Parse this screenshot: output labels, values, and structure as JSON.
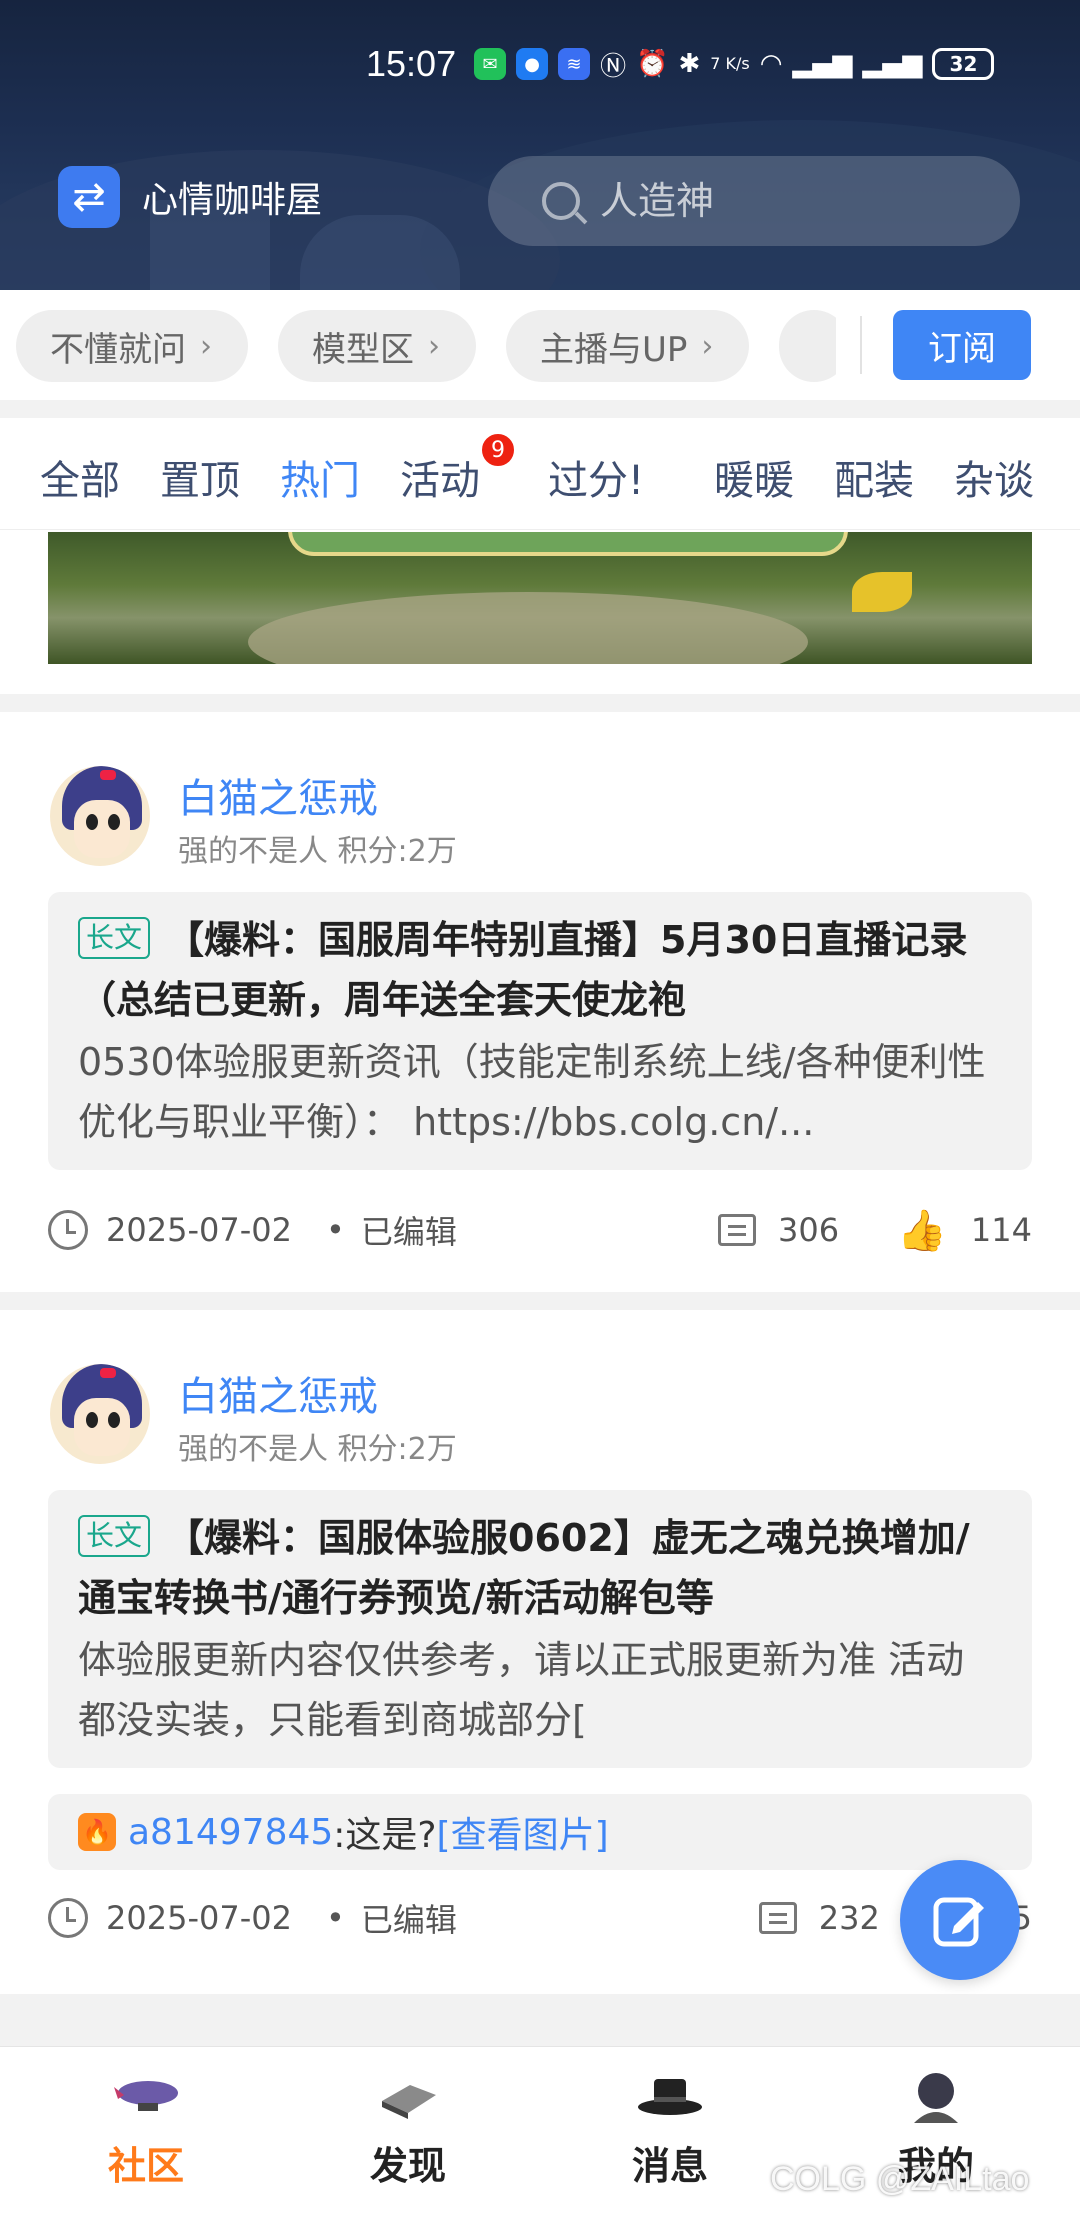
{
  "status_bar": {
    "time": "15:07",
    "net_speed": "7 K/s",
    "battery": "32"
  },
  "header": {
    "app_title": "心情咖啡屋",
    "search_placeholder": "人造神"
  },
  "chips": [
    "不懂就问",
    "模型区",
    "主播与UP",
    ""
  ],
  "subscribe_label": "订阅",
  "tabs": [
    {
      "label": "全部"
    },
    {
      "label": "置顶"
    },
    {
      "label": "热门",
      "active": true
    },
    {
      "label": "活动",
      "badge": "9"
    },
    {
      "label": "过分!"
    },
    {
      "label": "暖暖"
    },
    {
      "label": "配装"
    },
    {
      "label": "杂谈"
    }
  ],
  "posts": [
    {
      "author": "白猫之惩戒",
      "author_meta": "强的不是人 积分:2万",
      "tag": "长文",
      "title": "【爆料：国服周年特别直播】5月30日直播记录（总结已更新，周年送全套天使龙袍",
      "excerpt": " 0530体验服更新资讯（技能定制系统上线/各种便利性优化与职业平衡）： https://bbs.colg.cn/...",
      "date": "2025-07-02",
      "edited": "已编辑",
      "comments": "306",
      "likes": "114"
    },
    {
      "author": "白猫之惩戒",
      "author_meta": "强的不是人 积分:2万",
      "tag": "长文",
      "title": "【爆料：国服体验服0602】虚无之魂兑换增加/通宝转换书/通行券预览/新活动解包等",
      "excerpt": " 体验服更新内容仅供参考，请以正式服更新为准 活动都没实装，只能看到商城部分[",
      "reply_user": "a81497845",
      "reply_text": ":这是?",
      "reply_link": "[查看图片]",
      "date": "2025-07-02",
      "edited": "已编辑",
      "comments": "232",
      "likes": "5"
    }
  ],
  "bottom_nav": [
    {
      "label": "社区",
      "active": true
    },
    {
      "label": "发现"
    },
    {
      "label": "消息"
    },
    {
      "label": "我的"
    }
  ],
  "watermark": "COLG @ZAILtao",
  "colors": {
    "accent": "#3f86f5",
    "nav_active": "#ff7a1a",
    "tag_green": "#1aa78c",
    "badge_red": "#ee2211"
  }
}
